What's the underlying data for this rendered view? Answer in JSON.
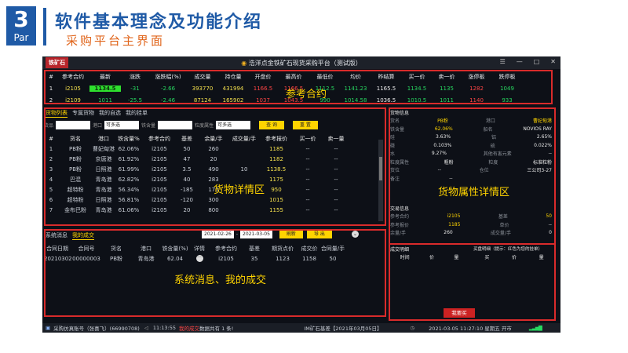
{
  "slide": {
    "number": "3",
    "part": "Par",
    "title": "软件基本理念及功能介绍",
    "subtitle": "采购平台主界面"
  },
  "app": {
    "logo": "铁矿石",
    "title": "浩洋点金铁矿石现货采购平台（测试版）",
    "window_controls": [
      "☰",
      "—",
      "□",
      "✕"
    ]
  },
  "quote_table": {
    "headers": [
      "#",
      "参考合约",
      "最新",
      "涨跌",
      "涨跌幅(%)",
      "成交量",
      "持仓量",
      "开盘价",
      "最高价",
      "最低价",
      "均价",
      "昨结算",
      "买一价",
      "卖一价",
      "涨停板",
      "跌停板"
    ],
    "rows": [
      [
        "1",
        "i2105",
        "1134.5",
        "-31",
        "-2.66",
        "393770",
        "431994",
        "1166.5",
        "1166.5",
        "1112.5",
        "1141.23",
        "1165.5",
        "1134.5",
        "1135",
        "1282",
        "1049"
      ],
      [
        "2",
        "i2109",
        "1011",
        "-25.5",
        "-2.46",
        "87124",
        "165902",
        "1037",
        "1043.5",
        "990",
        "1014.58",
        "1036.5",
        "1010.5",
        "1011",
        "1140",
        "933"
      ]
    ]
  },
  "annotations": {
    "quote": "参考合约",
    "goods": "货物详情区",
    "attrs": "货物属性详情区",
    "messages": "系统消息、我的成交"
  },
  "goods_panel": {
    "tabs": [
      "货物列表",
      "专属货物",
      "我的自选",
      "我的挂单"
    ],
    "filter_labels": [
      "货品",
      "港口",
      "铁含量",
      "粒度属性"
    ],
    "filter_values": [
      "",
      "可多选",
      "",
      "可多选"
    ],
    "query_label": "查 询",
    "reset_label": "重 置",
    "headers": [
      "#",
      "货名",
      "港口",
      "铁含量%",
      "参考合约",
      "基差",
      "余量/手",
      "成交量/手",
      "参考报价",
      "买一价",
      "卖一量"
    ],
    "rows": [
      [
        "1",
        "PB粉",
        "曹妃甸港",
        "62.06%",
        "i2105",
        "50",
        "260",
        "",
        "1185",
        "--",
        "--"
      ],
      [
        "2",
        "PB粉",
        "京唐港",
        "61.92%",
        "i2105",
        "47",
        "20",
        "",
        "1182",
        "--",
        "--"
      ],
      [
        "3",
        "PB粉",
        "日照港",
        "61.99%",
        "i2105",
        "3.5",
        "490",
        "10",
        "1138.5",
        "--",
        "--"
      ],
      [
        "4",
        "巴混",
        "青岛港",
        "62.82%",
        "i2105",
        "40",
        "283",
        "",
        "1175",
        "--",
        "--"
      ],
      [
        "5",
        "超特粉",
        "青岛港",
        "56.34%",
        "i2105",
        "-185",
        "170",
        "",
        "950",
        "--",
        "--"
      ],
      [
        "6",
        "超特粉",
        "日照港",
        "56.81%",
        "i2105",
        "-120",
        "300",
        "",
        "1015",
        "--",
        "--"
      ],
      [
        "7",
        "金布巴粉",
        "青岛港",
        "61.06%",
        "i2105",
        "20",
        "800",
        "",
        "1155",
        "--",
        "--"
      ]
    ]
  },
  "bottom_panel": {
    "tabs": [
      "系统消息",
      "我的成交"
    ],
    "date_from": "2021-02-26",
    "date_to": "2021-03-05",
    "refresh_label": "刷新",
    "export_label": "导 出",
    "headers": [
      "合同日期",
      "合同号",
      "货名",
      "港口",
      "铁含量(%)",
      "详情",
      "参考合约",
      "基差",
      "期货点价",
      "成交价",
      "合同量/手"
    ],
    "rows": [
      [
        "20210302",
        "00000003",
        "PB粉",
        "青岛港",
        "62.04",
        "···",
        "i2105",
        "35",
        "1123",
        "1158",
        "50"
      ]
    ]
  },
  "goods_info": {
    "title": "货物信息",
    "rows": [
      [
        "货名",
        "PB粉",
        "港口",
        "曹妃甸港"
      ],
      [
        "铁含量",
        "62.06%",
        "船名",
        "NOVIOS RAY"
      ],
      [
        "硅",
        "3.63%",
        "铝",
        "2.65%"
      ],
      [
        "磷",
        "0.103%",
        "硫",
        "0.022%"
      ],
      [
        "水",
        "9.27%",
        "其他有害元素",
        "--"
      ],
      [
        "粒度属性",
        "粗粉",
        "粒度",
        "标准粒粉"
      ],
      [
        "货位",
        "--",
        "仓位",
        "三公司3-27"
      ],
      [
        "备注",
        "--",
        "",
        ""
      ]
    ]
  },
  "trade_info": {
    "title": "交易信息",
    "rows": [
      [
        "参考合约",
        "i2105",
        "基差",
        "50"
      ],
      [
        "参考报价",
        "1185",
        "单价",
        "--"
      ],
      [
        "余量/手",
        "260",
        "成交量/手",
        "0"
      ]
    ]
  },
  "deal_detail": {
    "title": "成交明细",
    "headers": [
      "时间",
      "价",
      "量"
    ]
  },
  "buy_detail": {
    "title": "买盘明细（提示：红色为您的挂单）",
    "headers": [
      "买",
      "价",
      "量"
    ],
    "buy_button": "我要买"
  },
  "statusbar": {
    "user": "采购仿真账号（张喜飞）(66990708)",
    "time": "11:13:55",
    "msg_highlight": "我的成交",
    "msg_rest": "数据共有 1 条!",
    "center": "IM矿石基差【2021年03月05日】",
    "datetime": "2021-03-05 11:27:10 星期五 开市"
  }
}
